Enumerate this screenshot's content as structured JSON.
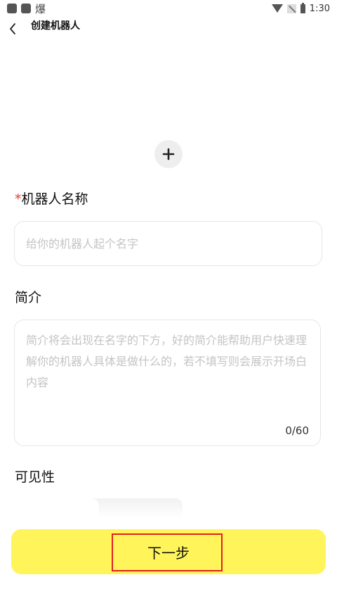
{
  "status_bar": {
    "app_glyph": "爆",
    "time": "1:30"
  },
  "header": {
    "title": "创建机器人"
  },
  "form": {
    "name": {
      "required_mark": "*",
      "label": "机器人名称",
      "value": "",
      "placeholder": "给你的机器人起个名字"
    },
    "intro": {
      "label": "简介",
      "value": "",
      "placeholder": "简介将会出现在名字的下方，好的简介能帮助用户快速理解你的机器人具体是做什么的，若不填写则会展示开场白内容",
      "char_count": "0/60"
    },
    "visibility": {
      "label": "可见性"
    }
  },
  "footer": {
    "next_label": "下一步",
    "highlight_color": "#e02020",
    "button_color": "#fff45a"
  },
  "icons": {
    "back": "chevron-left-icon",
    "add_avatar": "plus-icon"
  }
}
